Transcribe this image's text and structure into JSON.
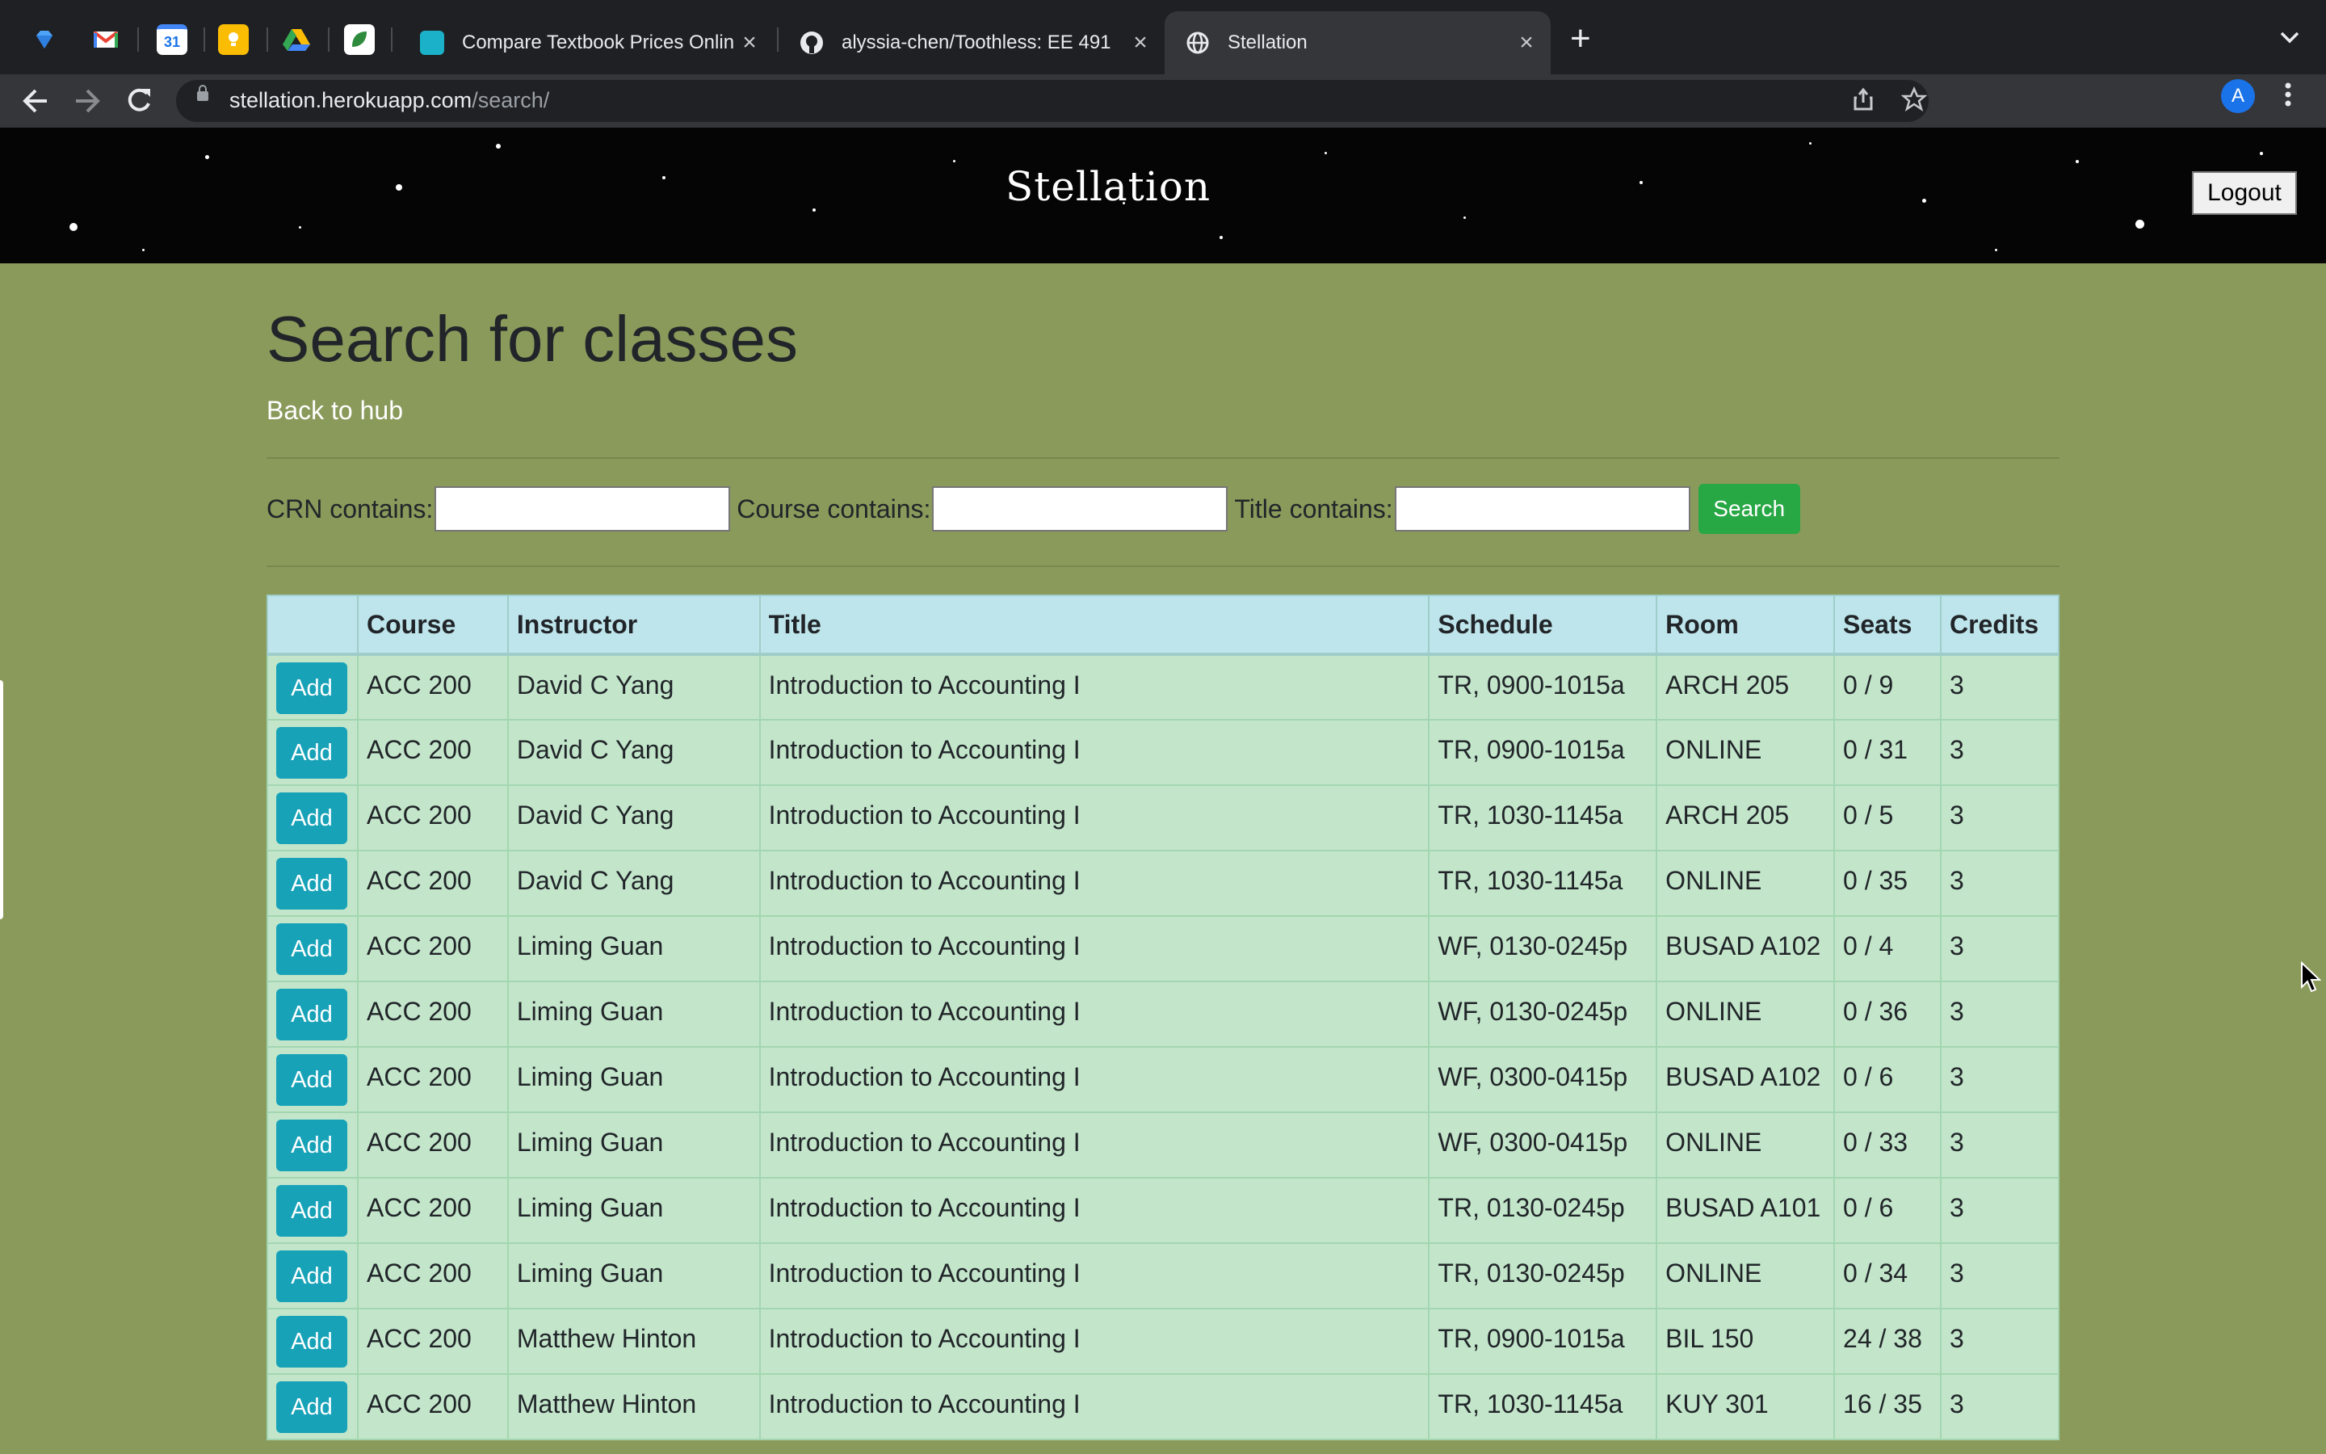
{
  "browser": {
    "pinned_tabs": [
      "gem-icon",
      "gmail-icon",
      "calendar-icon",
      "keep-icon",
      "drive-icon",
      "leaf-icon"
    ],
    "calendar_label": "31",
    "tabs": [
      {
        "title": "Compare Textbook Prices Onlin",
        "close": "×"
      },
      {
        "title": "alyssia-chen/Toothless: EE 491",
        "close": "×"
      },
      {
        "title": "Stellation",
        "close": "×"
      }
    ],
    "new_tab": "+",
    "url_host": "stellation.herokuapp.com",
    "url_path": "/search/",
    "profile_initial": "A"
  },
  "header": {
    "brand": "Stellation",
    "logout_label": "Logout"
  },
  "page": {
    "title": "Search for classes",
    "back_link": "Back to hub"
  },
  "search": {
    "crn_label": "CRN contains:",
    "crn_value": "",
    "course_label": "Course contains:",
    "course_value": "",
    "title_label": "Title contains:",
    "title_value": "",
    "button_label": "Search"
  },
  "table": {
    "add_label": "Add",
    "columns": [
      "",
      "Course",
      "Instructor",
      "Title",
      "Schedule",
      "Room",
      "Seats",
      "Credits"
    ],
    "rows": [
      {
        "course": "ACC 200",
        "instructor": "David C Yang",
        "title": "Introduction to Accounting I",
        "schedule": "TR, 0900-1015a",
        "room": "ARCH 205",
        "seats": "0 / 9",
        "credits": "3"
      },
      {
        "course": "ACC 200",
        "instructor": "David C Yang",
        "title": "Introduction to Accounting I",
        "schedule": "TR, 0900-1015a",
        "room": "ONLINE",
        "seats": "0 / 31",
        "credits": "3"
      },
      {
        "course": "ACC 200",
        "instructor": "David C Yang",
        "title": "Introduction to Accounting I",
        "schedule": "TR, 1030-1145a",
        "room": "ARCH 205",
        "seats": "0 / 5",
        "credits": "3"
      },
      {
        "course": "ACC 200",
        "instructor": "David C Yang",
        "title": "Introduction to Accounting I",
        "schedule": "TR, 1030-1145a",
        "room": "ONLINE",
        "seats": "0 / 35",
        "credits": "3"
      },
      {
        "course": "ACC 200",
        "instructor": "Liming Guan",
        "title": "Introduction to Accounting I",
        "schedule": "WF, 0130-0245p",
        "room": "BUSAD A102",
        "seats": "0 / 4",
        "credits": "3"
      },
      {
        "course": "ACC 200",
        "instructor": "Liming Guan",
        "title": "Introduction to Accounting I",
        "schedule": "WF, 0130-0245p",
        "room": "ONLINE",
        "seats": "0 / 36",
        "credits": "3"
      },
      {
        "course": "ACC 200",
        "instructor": "Liming Guan",
        "title": "Introduction to Accounting I",
        "schedule": "WF, 0300-0415p",
        "room": "BUSAD A102",
        "seats": "0 / 6",
        "credits": "3"
      },
      {
        "course": "ACC 200",
        "instructor": "Liming Guan",
        "title": "Introduction to Accounting I",
        "schedule": "WF, 0300-0415p",
        "room": "ONLINE",
        "seats": "0 / 33",
        "credits": "3"
      },
      {
        "course": "ACC 200",
        "instructor": "Liming Guan",
        "title": "Introduction to Accounting I",
        "schedule": "TR, 0130-0245p",
        "room": "BUSAD A101",
        "seats": "0 / 6",
        "credits": "3"
      },
      {
        "course": "ACC 200",
        "instructor": "Liming Guan",
        "title": "Introduction to Accounting I",
        "schedule": "TR, 0130-0245p",
        "room": "ONLINE",
        "seats": "0 / 34",
        "credits": "3"
      },
      {
        "course": "ACC 200",
        "instructor": "Matthew Hinton",
        "title": "Introduction to Accounting I",
        "schedule": "TR, 0900-1015a",
        "room": "BIL 150",
        "seats": "24 / 38",
        "credits": "3"
      },
      {
        "course": "ACC 200",
        "instructor": "Matthew Hinton",
        "title": "Introduction to Accounting I",
        "schedule": "TR, 1030-1145a",
        "room": "KUY 301",
        "seats": "16 / 35",
        "credits": "3"
      }
    ]
  },
  "colors": {
    "page_bg": "#8a9a5b",
    "header_row": "#bee5eb",
    "body_row": "#c3e6cb",
    "add_button": "#17a2b8",
    "search_button": "#28a745"
  }
}
